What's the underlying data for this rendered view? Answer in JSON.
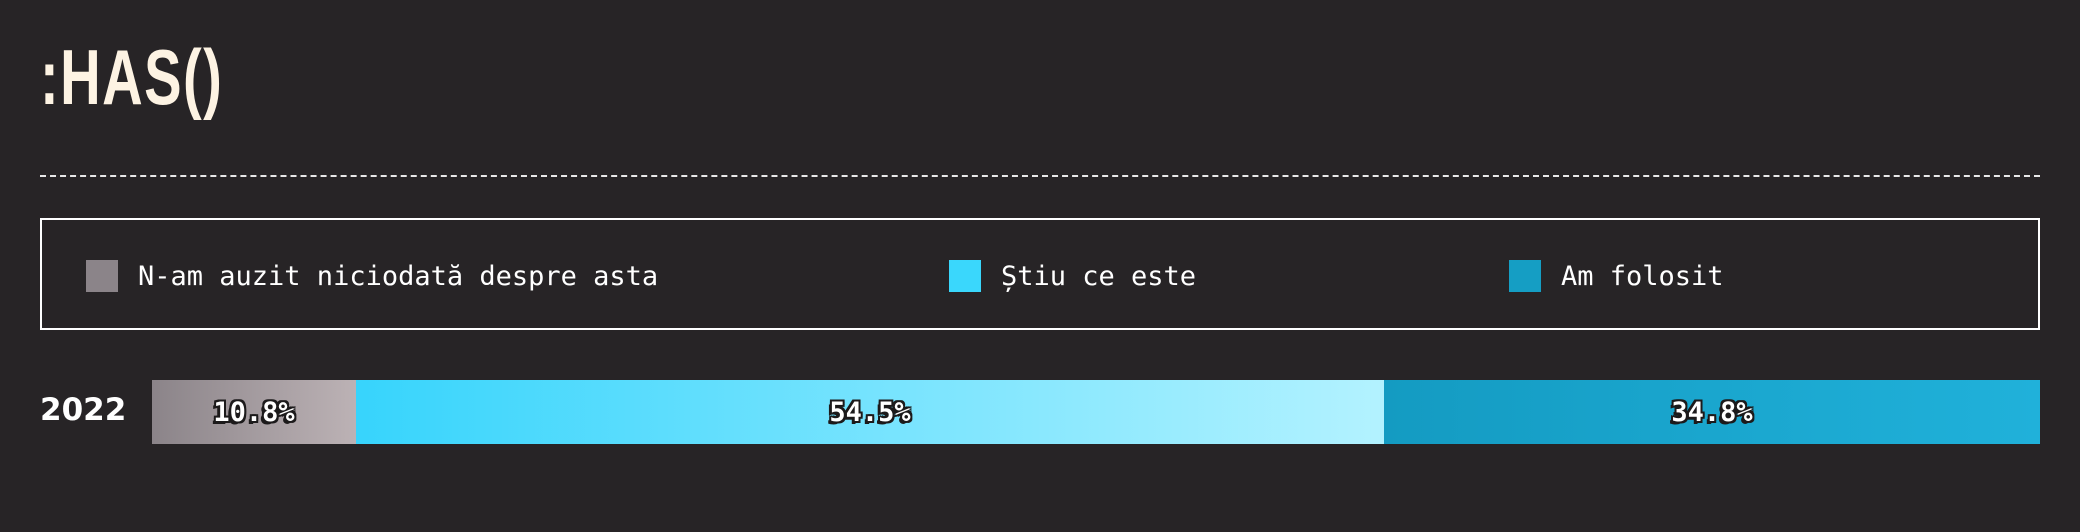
{
  "page": {
    "title": ":HAS()"
  },
  "legend": {
    "items": [
      {
        "label": "N-am auzit niciodată despre asta",
        "color": "#8b8489"
      },
      {
        "label": "Știu ce este",
        "color": "#3ad7fc"
      },
      {
        "label": "Am folosit",
        "color": "#159ec4"
      }
    ]
  },
  "chart_data": {
    "type": "bar",
    "orientation": "horizontal-stacked",
    "categories": [
      "2022"
    ],
    "series": [
      {
        "name": "N-am auzit niciodată despre asta",
        "values": [
          10.8
        ],
        "label": "10.8%",
        "gradient": [
          "#8b8489",
          "#bcb2b5"
        ]
      },
      {
        "name": "Știu ce este",
        "values": [
          54.5
        ],
        "label": "54.5%",
        "gradient": [
          "#37d4fc",
          "#b3f2ff"
        ]
      },
      {
        "name": "Am folosit",
        "values": [
          34.8
        ],
        "label": "34.8%",
        "gradient": [
          "#149bc2",
          "#20b1da"
        ]
      }
    ],
    "legend_position": "top",
    "grid": false
  }
}
